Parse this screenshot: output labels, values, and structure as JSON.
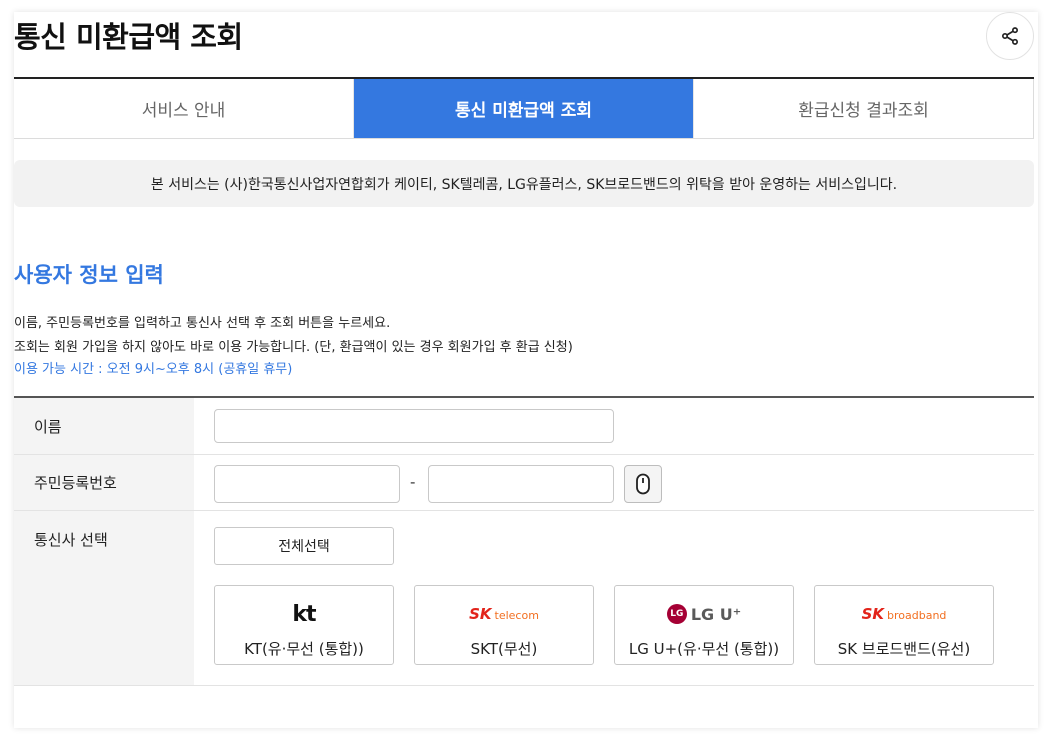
{
  "header": {
    "title": "통신 미환급액 조회",
    "share_icon": "share-icon"
  },
  "tabs": [
    {
      "label": "서비스 안내",
      "active": false
    },
    {
      "label": "통신 미환급액 조회",
      "active": true
    },
    {
      "label": "환급신청 결과조회",
      "active": false
    }
  ],
  "notice": "본 서비스는 (사)한국통신사업자연합회가 케이티, SK텔레콤, LG유플러스, SK브로드밴드의 위탁을 받아 운영하는 서비스입니다.",
  "section": {
    "title": "사용자 정보 입력",
    "desc1": "이름, 주민등록번호를 입력하고 통신사 선택 후 조회 버튼을 누르세요.",
    "desc2": "조회는 회원 가입을 하지 않아도 바로 이용 가능합니다. (단, 환급액이 있는 경우 회원가입 후 환급 신청)",
    "hours": "이용 가능 시간 : 오전 9시~오후 8시 (공휴일 휴무)"
  },
  "form": {
    "name_label": "이름",
    "name_value": "",
    "rrn_label": "주민등록번호",
    "rrn_front_value": "",
    "rrn_back_value": "",
    "rrn_separator": "-",
    "keyboard_icon": "secure-keypad-icon",
    "carrier_label": "통신사 선택",
    "select_all_label": "전체선택",
    "carriers": [
      {
        "logo_text": "kt",
        "name": "KT(유·무선 (통합))"
      },
      {
        "logo_text": "SK telecom",
        "name": "SKT(무선)"
      },
      {
        "logo_text": "LG U⁺",
        "name": "LG U+(유·무선 (통합))"
      },
      {
        "logo_text": "SK broadband",
        "name": "SK 브로드밴드(유선)"
      }
    ]
  },
  "colors": {
    "accent": "#3478e0",
    "notice_bg": "#f2f2f2",
    "label_bg": "#f4f4f4",
    "sk_red": "#e2231a",
    "sk_orange": "#f26f21",
    "lg_red": "#a50034"
  }
}
